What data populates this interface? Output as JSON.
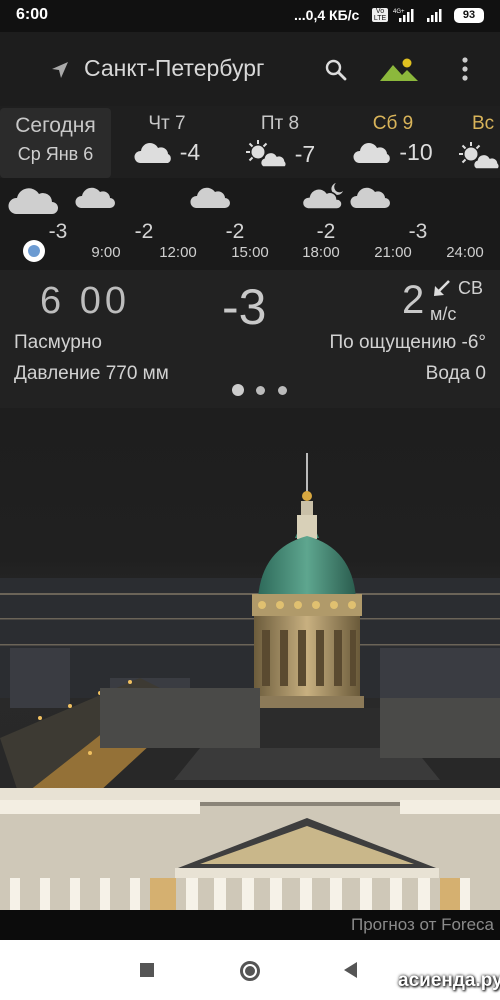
{
  "status_bar": {
    "time": "6:00",
    "network_speed": "...0,4 КБ/с",
    "volte": "Vo LTE",
    "battery": "93",
    "signal_label": "4G+"
  },
  "header": {
    "city": "Санкт-Петербург",
    "icons": [
      "navigation-arrow-icon",
      "search-icon",
      "landscape-icon",
      "more-vert-icon"
    ],
    "accent_color": "#e0c020"
  },
  "days": [
    {
      "label": "Сегодня",
      "sub": "Ср Янв 6",
      "selected": true
    },
    {
      "label": "Чт 7",
      "temp": "-4",
      "icon": "cloud-icon"
    },
    {
      "label": "Пт 8",
      "temp": "-7",
      "icon": "sun-cloud-icon"
    },
    {
      "label": "Сб 9",
      "temp": "-10",
      "icon": "cloud-icon",
      "weekend": true
    },
    {
      "label": "Вс",
      "icon": "sun-cloud-icon",
      "weekend": true
    }
  ],
  "hourly": {
    "temps": [
      "-3",
      "-2",
      "-2",
      "-2",
      "-3"
    ],
    "times": [
      "9:00",
      "12:00",
      "15:00",
      "18:00",
      "21:00",
      "24:00"
    ],
    "icons": [
      "cloud-icon",
      "cloud-icon",
      "cloud-icon",
      "moon-cloud-icon",
      "cloud-icon"
    ]
  },
  "current": {
    "time": "6 00",
    "temp": "-3",
    "wind_speed": "2",
    "wind_dir": "СВ",
    "wind_unit": "м/с",
    "condition": "Пасмурно",
    "feels_like": "По ощущению -6°",
    "pressure": "Давление 770 мм",
    "water": "Вода 0"
  },
  "credit": "Прогноз от Foreca",
  "watermark": "асиенда.ру"
}
